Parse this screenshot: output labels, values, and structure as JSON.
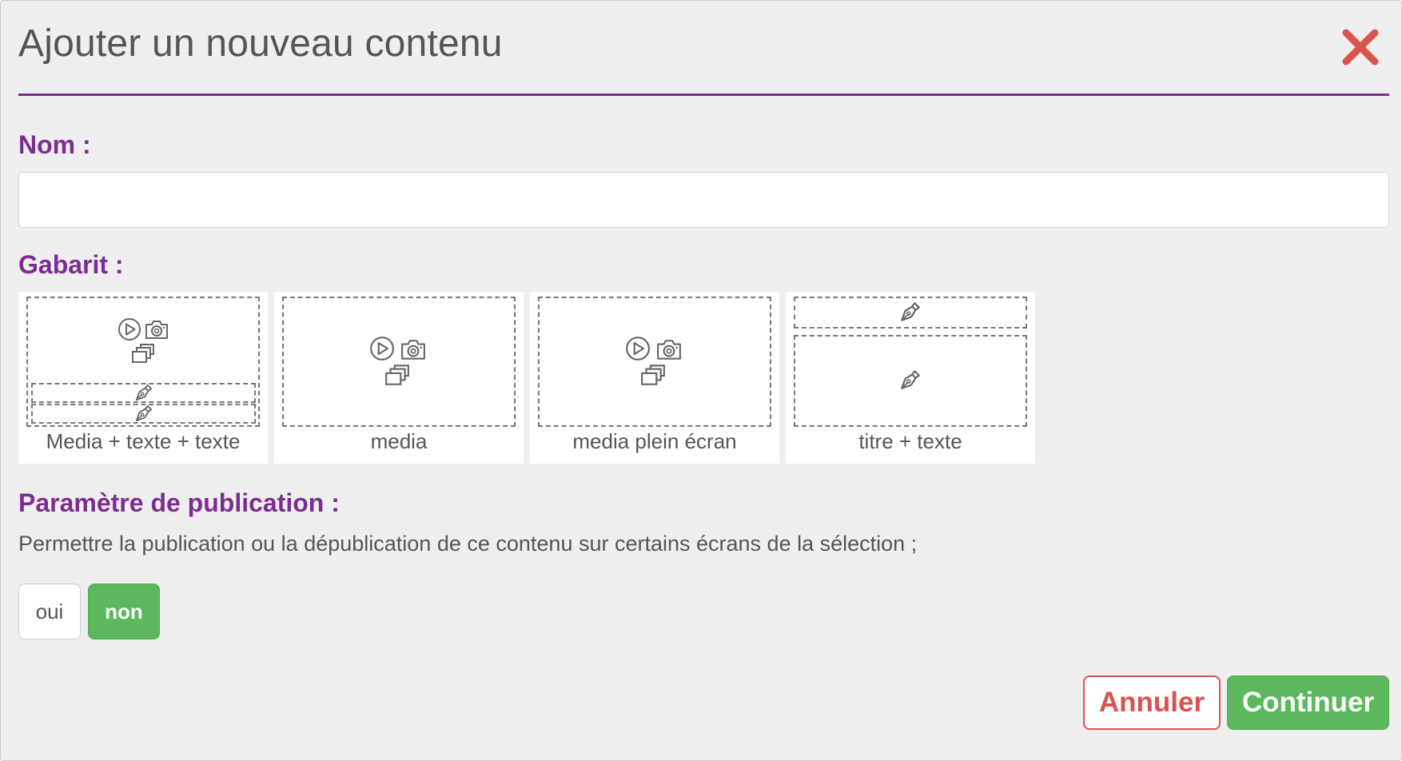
{
  "dialog": {
    "title": "Ajouter un nouveau contenu",
    "close_icon": "close-x-icon"
  },
  "colors": {
    "accent": "#7d2d91",
    "success": "#5cb85c",
    "danger": "#d9534f",
    "text": "#555555",
    "background": "#efefef"
  },
  "name_section": {
    "label": "Nom :",
    "value": "",
    "placeholder": ""
  },
  "template_section": {
    "label": "Gabarit :",
    "templates": [
      {
        "label": "Media + texte + texte",
        "icons": [
          "play-icon",
          "camera-icon",
          "gallery-icon",
          "pen-icon",
          "pen-icon"
        ]
      },
      {
        "label": "media",
        "icons": [
          "play-icon",
          "camera-icon",
          "gallery-icon"
        ]
      },
      {
        "label": "media plein écran",
        "icons": [
          "play-icon",
          "camera-icon",
          "gallery-icon"
        ]
      },
      {
        "label": "titre + texte",
        "icons": [
          "pen-icon",
          "pen-icon"
        ]
      }
    ]
  },
  "publication_section": {
    "label": "Paramètre de publication :",
    "description": "Permettre la publication ou la dépublication de ce contenu sur certains écrans de la sélection ;",
    "options": [
      "oui",
      "non"
    ],
    "selected": "non"
  },
  "footer": {
    "cancel_label": "Annuler",
    "continue_label": "Continuer"
  }
}
